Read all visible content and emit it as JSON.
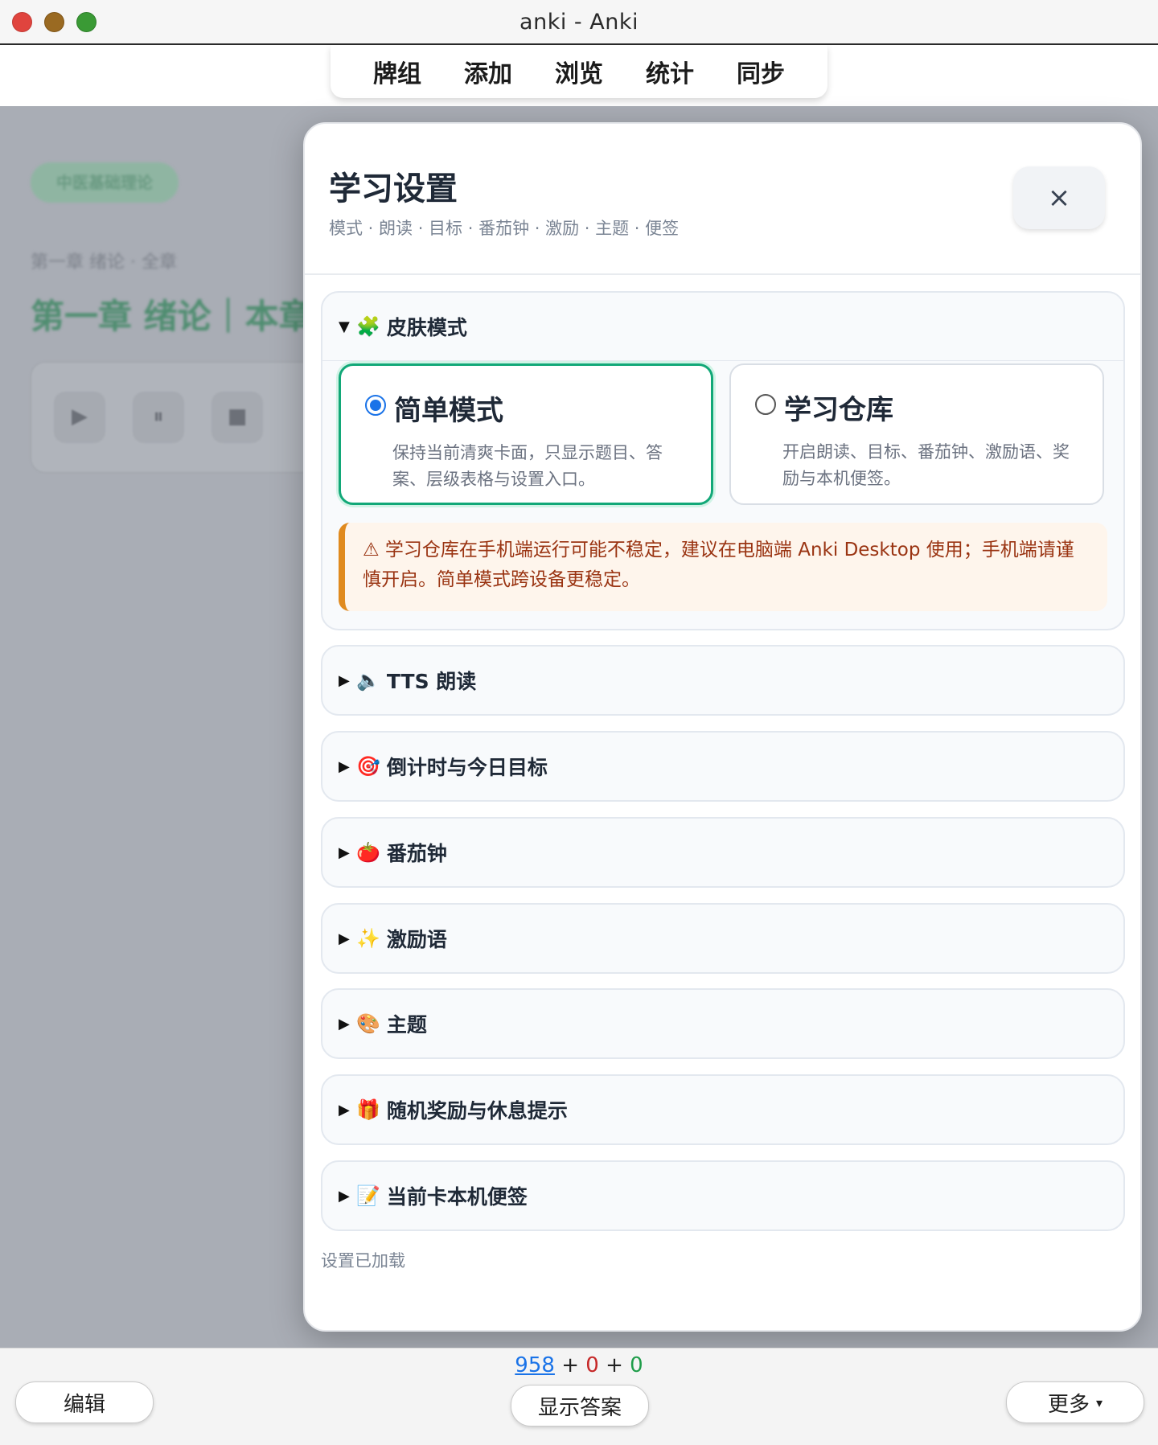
{
  "window": {
    "title": "anki - Anki"
  },
  "menu": {
    "items": [
      "牌组",
      "添加",
      "浏览",
      "统计",
      "同步"
    ]
  },
  "background": {
    "tag": "中医基础理论",
    "breadcrumb": "第一章 绪论 · 全章",
    "heading": "第一章 绪论｜本章",
    "player_icons": [
      "▶",
      "⏸",
      "■"
    ]
  },
  "modal": {
    "title": "学习设置",
    "subtitle": "模式 · 朗读 · 目标 · 番茄钟 · 激励 · 主题 · 便签",
    "close_icon": "×",
    "skin": {
      "label": "皮肤模式",
      "emoji": "🧩",
      "expanded": true,
      "options": [
        {
          "title": "简单模式",
          "desc": "保持当前清爽卡面，只显示题目、答案、层级表格与设置入口。",
          "selected": true
        },
        {
          "title": "学习仓库",
          "desc": "开启朗读、目标、番茄钟、激励语、奖励与本机便签。",
          "selected": false
        }
      ],
      "warning": "⚠ 学习仓库在手机端运行可能不稳定，建议在电脑端 Anki Desktop 使用；手机端请谨慎开启。简单模式跨设备更稳定。"
    },
    "sections": [
      {
        "emoji": "🔈",
        "label": "TTS 朗读"
      },
      {
        "emoji": "🎯",
        "label": "倒计时与今日目标"
      },
      {
        "emoji": "🍅",
        "label": "番茄钟"
      },
      {
        "emoji": "✨",
        "label": "激励语"
      },
      {
        "emoji": "🎨",
        "label": "主题"
      },
      {
        "emoji": "🎁",
        "label": "随机奖励与休息提示"
      },
      {
        "emoji": "📝",
        "label": "当前卡本机便签"
      }
    ],
    "status": "设置已加载"
  },
  "bottom": {
    "counts": {
      "new": "958",
      "learn": "0",
      "review": "0",
      "sep": "+"
    },
    "edit": "编辑",
    "show_answer": "显示答案",
    "more": "更多",
    "more_caret": "▾"
  },
  "colors": {
    "accent": "#12a878",
    "radio": "#1a73e8",
    "warning_text": "#9a3412",
    "warning_bar": "#e08a1e"
  }
}
